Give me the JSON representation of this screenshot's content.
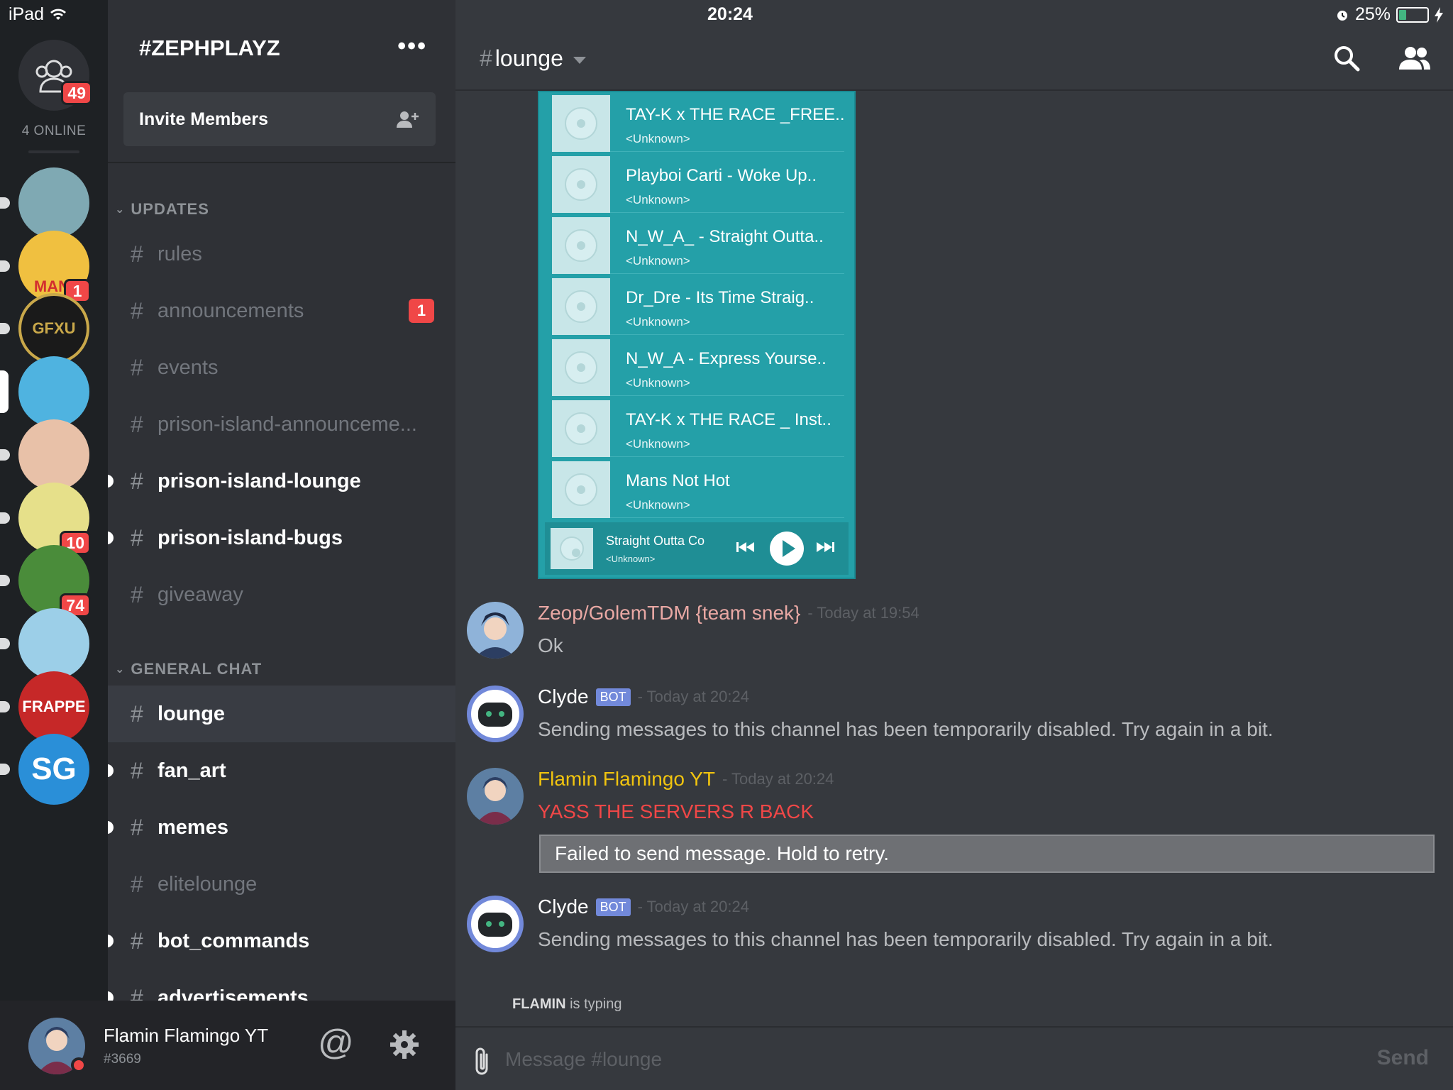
{
  "status_bar": {
    "device": "iPad",
    "time": "20:24",
    "battery": "25%",
    "battery_level": 0.25
  },
  "guild_bar": {
    "dm_badge": "49",
    "online": "4 ONLINE",
    "guilds": [
      {
        "name": "lake",
        "badge": "",
        "color": "#7fa9b3",
        "unread": true
      },
      {
        "name": "mango",
        "badge": "1",
        "color": "#f0c040",
        "unread": true,
        "text": "MANI"
      },
      {
        "name": "gfxu",
        "badge": "",
        "color": "#1a1a1a",
        "unread": true,
        "text": "GFXU"
      },
      {
        "name": "panda",
        "badge": "",
        "color": "#4fb3e0",
        "selected": true
      },
      {
        "name": "anime-girl",
        "badge": "",
        "color": "#e8c1a8",
        "unread": true
      },
      {
        "name": "blonde-girl",
        "badge": "10",
        "color": "#e6e08a",
        "unread": true
      },
      {
        "name": "pepe",
        "badge": "74",
        "color": "#4a8c3a",
        "unread": true
      },
      {
        "name": "fairy",
        "badge": "",
        "color": "#9ccfe8",
        "unread": true
      },
      {
        "name": "frappe",
        "badge": "",
        "color": "#c62828",
        "unread": true,
        "text": "FRAPPE"
      },
      {
        "name": "sg",
        "badge": "",
        "color": "#2a8fd8",
        "unread": true,
        "text": "SG"
      }
    ]
  },
  "server": {
    "name": "#ZEPHPLAYZ",
    "more": "•••",
    "invite_label": "Invite Members",
    "categories": [
      {
        "label": "UPDATES"
      },
      {
        "label": "GENERAL CHAT"
      }
    ],
    "channels": [
      {
        "name": "rules",
        "state": "read"
      },
      {
        "name": "announcements",
        "state": "read",
        "badge": "1"
      },
      {
        "name": "events",
        "state": "read"
      },
      {
        "name": "prison-island-announceme...",
        "state": "read"
      },
      {
        "name": "prison-island-lounge",
        "state": "unread"
      },
      {
        "name": "prison-island-bugs",
        "state": "unread"
      },
      {
        "name": "giveaway",
        "state": "read"
      },
      {
        "name": "lounge",
        "state": "active"
      },
      {
        "name": "fan_art",
        "state": "unread"
      },
      {
        "name": "memes",
        "state": "unread"
      },
      {
        "name": "elitelounge",
        "state": "locked"
      },
      {
        "name": "bot_commands",
        "state": "unread"
      },
      {
        "name": "advertisements",
        "state": "unread"
      }
    ]
  },
  "user": {
    "name": "Flamin Flamingo YT",
    "tag": "#3669",
    "mention_icon": "@"
  },
  "chat": {
    "hash": "#",
    "channel": "lounge",
    "embed": {
      "tracks": [
        {
          "title": "TAY-K x THE RACE _FREE..",
          "artist": "<Unknown>"
        },
        {
          "title": "Playboi Carti - Woke Up..",
          "artist": "<Unknown>"
        },
        {
          "title": "N_W_A_ - Straight Outta..",
          "artist": "<Unknown>"
        },
        {
          "title": "Dr_Dre - Its Time Straig..",
          "artist": "<Unknown>"
        },
        {
          "title": "N_W_A - Express Yourse..",
          "artist": "<Unknown>"
        },
        {
          "title": "TAY-K x THE RACE _ Inst..",
          "artist": "<Unknown>"
        },
        {
          "title": "Mans Not Hot",
          "artist": "<Unknown>"
        }
      ],
      "now_playing": {
        "title": "Straight Outta Co",
        "artist": "<Unknown>"
      }
    },
    "messages": [
      {
        "author": "Zeop/GolemTDM {team snek}",
        "author_color": "#e9a8a4",
        "time": "- Today at 19:54",
        "text": "Ok"
      },
      {
        "author": "Clyde",
        "bot": "BOT",
        "author_color": "#ffffff",
        "time": "- Today at 20:24",
        "text": "Sending messages to this channel has been temporarily disabled. Try again in a bit."
      },
      {
        "author": "Flamin Flamingo YT",
        "author_color": "#f1c40f",
        "time": "- Today at 20:24",
        "text": "YASS THE SERVERS R BACK",
        "failed": "Failed to send message. Hold to retry."
      },
      {
        "author": "Clyde",
        "bot": "BOT",
        "author_color": "#ffffff",
        "time": "- Today at 20:24",
        "text": "Sending messages to this channel has been temporarily disabled. Try again in a bit."
      }
    ],
    "typing": {
      "user": "FLAMIN",
      "suffix": " is typing"
    },
    "composer": {
      "placeholder": "Message #lounge",
      "send": "Send"
    }
  }
}
